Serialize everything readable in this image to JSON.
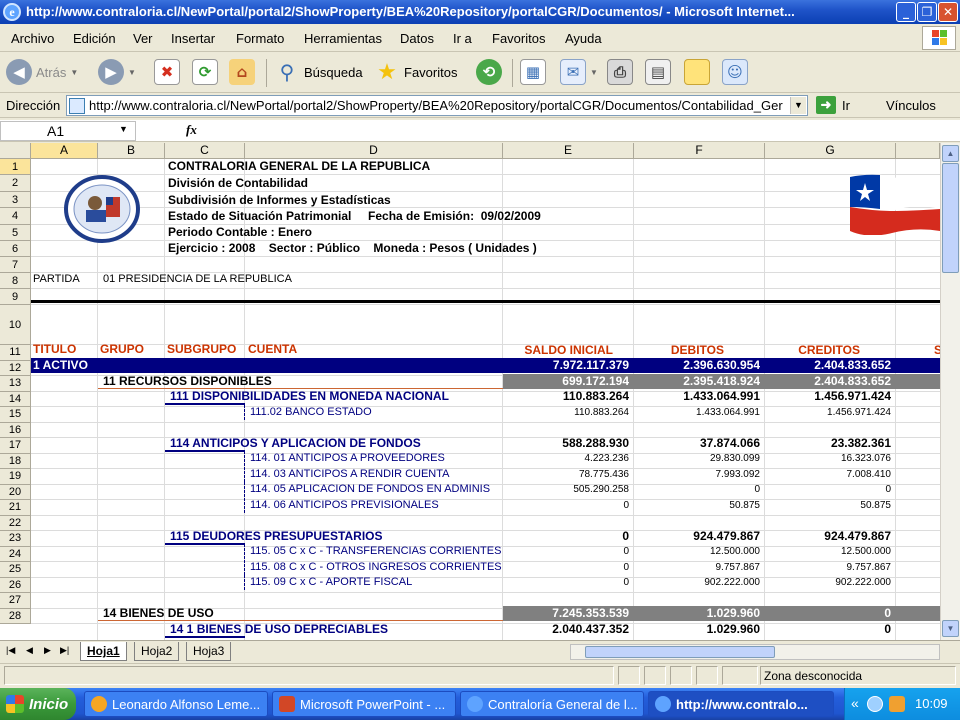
{
  "window": {
    "title": "http://www.contraloria.cl/NewPortal/portal2/ShowProperty/BEA%20Repository/portalCGR/Documentos/ - Microsoft Internet..."
  },
  "menu": [
    "Archivo",
    "Edición",
    "Ver",
    "Insertar",
    "Formato",
    "Herramientas",
    "Datos",
    "Ir a",
    "Favoritos",
    "Ayuda"
  ],
  "toolbar": {
    "back": "Atrás",
    "search": "Búsqueda",
    "favorites": "Favoritos"
  },
  "address": {
    "label": "Dirección",
    "url": "http://www.contraloria.cl/NewPortal/portal2/ShowProperty/BEA%20Repository/portalCGR/Documentos/Contabilidad_Ger",
    "go": "Ir",
    "links": "Vínculos"
  },
  "formula": {
    "cell_ref": "A1",
    "fx": "fx"
  },
  "sheet": {
    "columns": [
      "A",
      "B",
      "C",
      "D",
      "E",
      "F",
      "G"
    ],
    "header": {
      "org": "CONTRALORIA GENERAL DE LA REPUBLICA",
      "division": "División de Contabilidad",
      "subdivision": "Subdivisión de Informes y Estadísticas",
      "report": "Estado de Situación Patrimonial     Fecha de Emisión:  09/02/2009",
      "period": "Periodo Contable : Enero",
      "exercise": "Ejercicio : 2008    Sector : Público    Moneda : Pesos ( Unidades )"
    },
    "partida_label": "PARTIDA",
    "partida_value": "01 PRESIDENCIA DE LA REPUBLICA",
    "col_headers": {
      "titulo": "TITULO",
      "grupo": "GRUPO",
      "subgrupo": "SUBGRUPO",
      "cuenta": "CUENTA",
      "saldo": "SALDO INICIAL",
      "debitos": "DEBITOS",
      "creditos": "CREDITOS"
    },
    "rows": [
      {
        "n": "11",
        "level": 1,
        "label": "1 ACTIVO",
        "e": "7.972.117.379",
        "f": "2.396.630.954",
        "g": "2.404.833.652"
      },
      {
        "n": "12",
        "level": 2,
        "label": "11 RECURSOS DISPONIBLES",
        "e": "699.172.194",
        "f": "2.395.418.924",
        "g": "2.404.833.652"
      },
      {
        "n": "13",
        "level": 3,
        "label": "111 DISPONIBILIDADES EN MONEDA NACIONAL",
        "e": "110.883.264",
        "f": "1.433.064.991",
        "g": "1.456.971.424"
      },
      {
        "n": "14",
        "level": 4,
        "label": "111.02 BANCO ESTADO",
        "e": "110.883.264",
        "f": "1.433.064.991",
        "g": "1.456.971.424"
      },
      {
        "n": "15",
        "level": 0,
        "label": "",
        "e": "",
        "f": "",
        "g": ""
      },
      {
        "n": "16",
        "level": 3,
        "label": "114 ANTICIPOS Y APLICACION DE FONDOS",
        "e": "588.288.930",
        "f": "37.874.066",
        "g": "23.382.361"
      },
      {
        "n": "17",
        "level": 4,
        "label": "114. 01 ANTICIPOS A PROVEEDORES",
        "e": "4.223.236",
        "f": "29.830.099",
        "g": "16.323.076"
      },
      {
        "n": "18",
        "level": 4,
        "label": "114. 03 ANTICIPOS A RENDIR CUENTA",
        "e": "78.775.436",
        "f": "7.993.092",
        "g": "7.008.410"
      },
      {
        "n": "19",
        "level": 4,
        "label": "114. 05 APLICACION DE FONDOS EN ADMINIS",
        "e": "505.290.258",
        "f": "0",
        "g": "0"
      },
      {
        "n": "20",
        "level": 4,
        "label": "114. 06 ANTICIPOS PREVISIONALES",
        "e": "0",
        "f": "50.875",
        "g": "50.875"
      },
      {
        "n": "21",
        "level": 0,
        "label": "",
        "e": "",
        "f": "",
        "g": ""
      },
      {
        "n": "22",
        "level": 3,
        "label": "115 DEUDORES PRESUPUESTARIOS",
        "e": "0",
        "f": "924.479.867",
        "g": "924.479.867"
      },
      {
        "n": "23",
        "level": 4,
        "label": "115. 05 C x C - TRANSFERENCIAS CORRIENTES",
        "e": "0",
        "f": "12.500.000",
        "g": "12.500.000"
      },
      {
        "n": "24",
        "level": 4,
        "label": "115. 08 C x C - OTROS INGRESOS CORRIENTES",
        "e": "0",
        "f": "9.757.867",
        "g": "9.757.867"
      },
      {
        "n": "25",
        "level": 4,
        "label": "115. 09 C x C - APORTE FISCAL",
        "e": "0",
        "f": "902.222.000",
        "g": "902.222.000"
      },
      {
        "n": "26",
        "level": 0,
        "label": "",
        "e": "",
        "f": "",
        "g": ""
      },
      {
        "n": "27",
        "level": 2,
        "label": "14 BIENES DE USO",
        "e": "7.245.353.539",
        "f": "1.029.960",
        "g": "0"
      },
      {
        "n": "28",
        "level": 3,
        "label": "14 1 BIENES DE USO DEPRECIABLES",
        "e": "2.040.437.352",
        "f": "1.029.960",
        "g": "0"
      }
    ]
  },
  "tabs": [
    "Hoja1",
    "Hoja2",
    "Hoja3"
  ],
  "status": {
    "zone": "Zona desconocida"
  },
  "taskbar": {
    "start": "Inicio",
    "tasks": [
      "Leonardo Alfonso Leme...",
      "Microsoft PowerPoint - ...",
      "Contraloría General de l...",
      "http://www.contralo..."
    ],
    "tray_chevron": "«",
    "clock": "10:09"
  },
  "colors": {
    "title_bar": "#0b3fb3",
    "level1_fill": "#000080",
    "level2_fill": "#808080",
    "column_header_text": "#cc3300",
    "account_text": "#000080"
  }
}
